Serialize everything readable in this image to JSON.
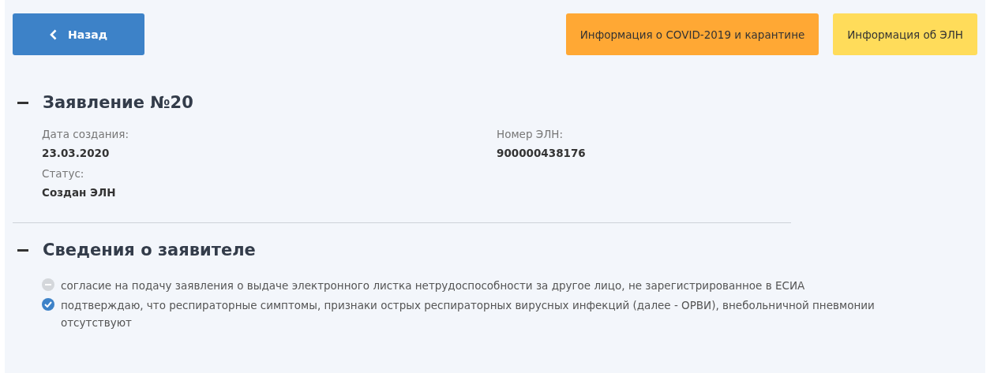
{
  "back_button": {
    "label": "Назад"
  },
  "info_buttons": [
    {
      "label": "Информация о COVID-2019 и карантине",
      "color": "#ffa834"
    },
    {
      "label": "Информация об ЭЛН",
      "color": "#ffdc5a"
    }
  ],
  "sections": [
    {
      "title": "Заявление №20",
      "expanded": true,
      "fields": [
        {
          "label": "Дата создания:",
          "value": "23.03.2020"
        },
        {
          "label": "Номер ЭЛН:",
          "value": "900000438176"
        },
        {
          "label": "Статус:",
          "value": "Создан ЭЛН"
        }
      ]
    },
    {
      "title": "Сведения о заявителе",
      "expanded": true,
      "consents": [
        {
          "text": "согласие на подачу заявления о выдаче электронного листка нетрудоспособности за другое лицо, не зарегистрированное в ЕСИА",
          "checked": false
        },
        {
          "text": "подтверждаю, что респираторные симптомы, признаки острых респираторных вирусных инфекций (далее - ОРВИ), внебольничной пневмонии отсутствуют",
          "checked": true
        }
      ]
    }
  ]
}
